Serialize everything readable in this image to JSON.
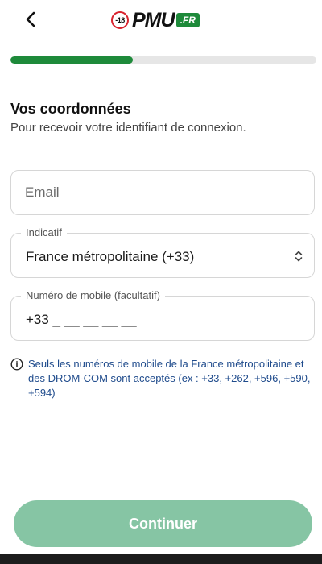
{
  "header": {
    "back_icon": "chevron-left-icon",
    "logo": {
      "age_badge": "-18",
      "brand": "PMU",
      "tld": ".FR"
    }
  },
  "progress": {
    "fraction": 0.4,
    "color": "#1e8a3a"
  },
  "section": {
    "title": "Vos coordonnées",
    "subtitle": "Pour recevoir votre identifiant de connexion."
  },
  "form": {
    "email": {
      "placeholder": "Email",
      "value": ""
    },
    "indicatif": {
      "label": "Indicatif",
      "selected": "France métropolitaine (+33)",
      "icon": "chevron-up-down-icon"
    },
    "mobile": {
      "label": "Numéro de mobile (facultatif)",
      "value": "+33 _ __ __ __ __"
    }
  },
  "info": {
    "icon": "info-icon",
    "text": "Seuls les numéros de mobile de la France métropolitaine et des DROM-COM sont acceptés (ex : +33, +262, +596, +590, +594)"
  },
  "actions": {
    "continue_label": "Continuer",
    "continue_color": "#86c5a4"
  }
}
